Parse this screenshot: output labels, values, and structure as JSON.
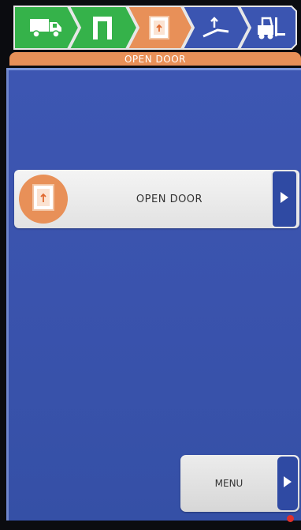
{
  "header": {
    "title": "OPEN DOOR",
    "steps": [
      {
        "icon": "truck-icon",
        "color": "#35b24a",
        "state": "done"
      },
      {
        "icon": "doorframe-icon",
        "color": "#35b24a",
        "state": "done"
      },
      {
        "icon": "door-icon",
        "color": "#e89058",
        "state": "active"
      },
      {
        "icon": "leveler-icon",
        "color": "#3b55b1",
        "state": "pending"
      },
      {
        "icon": "forklift-icon",
        "color": "#3b55b1",
        "state": "pending"
      }
    ]
  },
  "main": {
    "door_button_label": "OPEN DOOR"
  },
  "footer": {
    "menu_label": "MENU"
  },
  "colors": {
    "accent_orange": "#e89058",
    "done_green": "#35b24a",
    "panel_blue": "#3b55b1"
  }
}
